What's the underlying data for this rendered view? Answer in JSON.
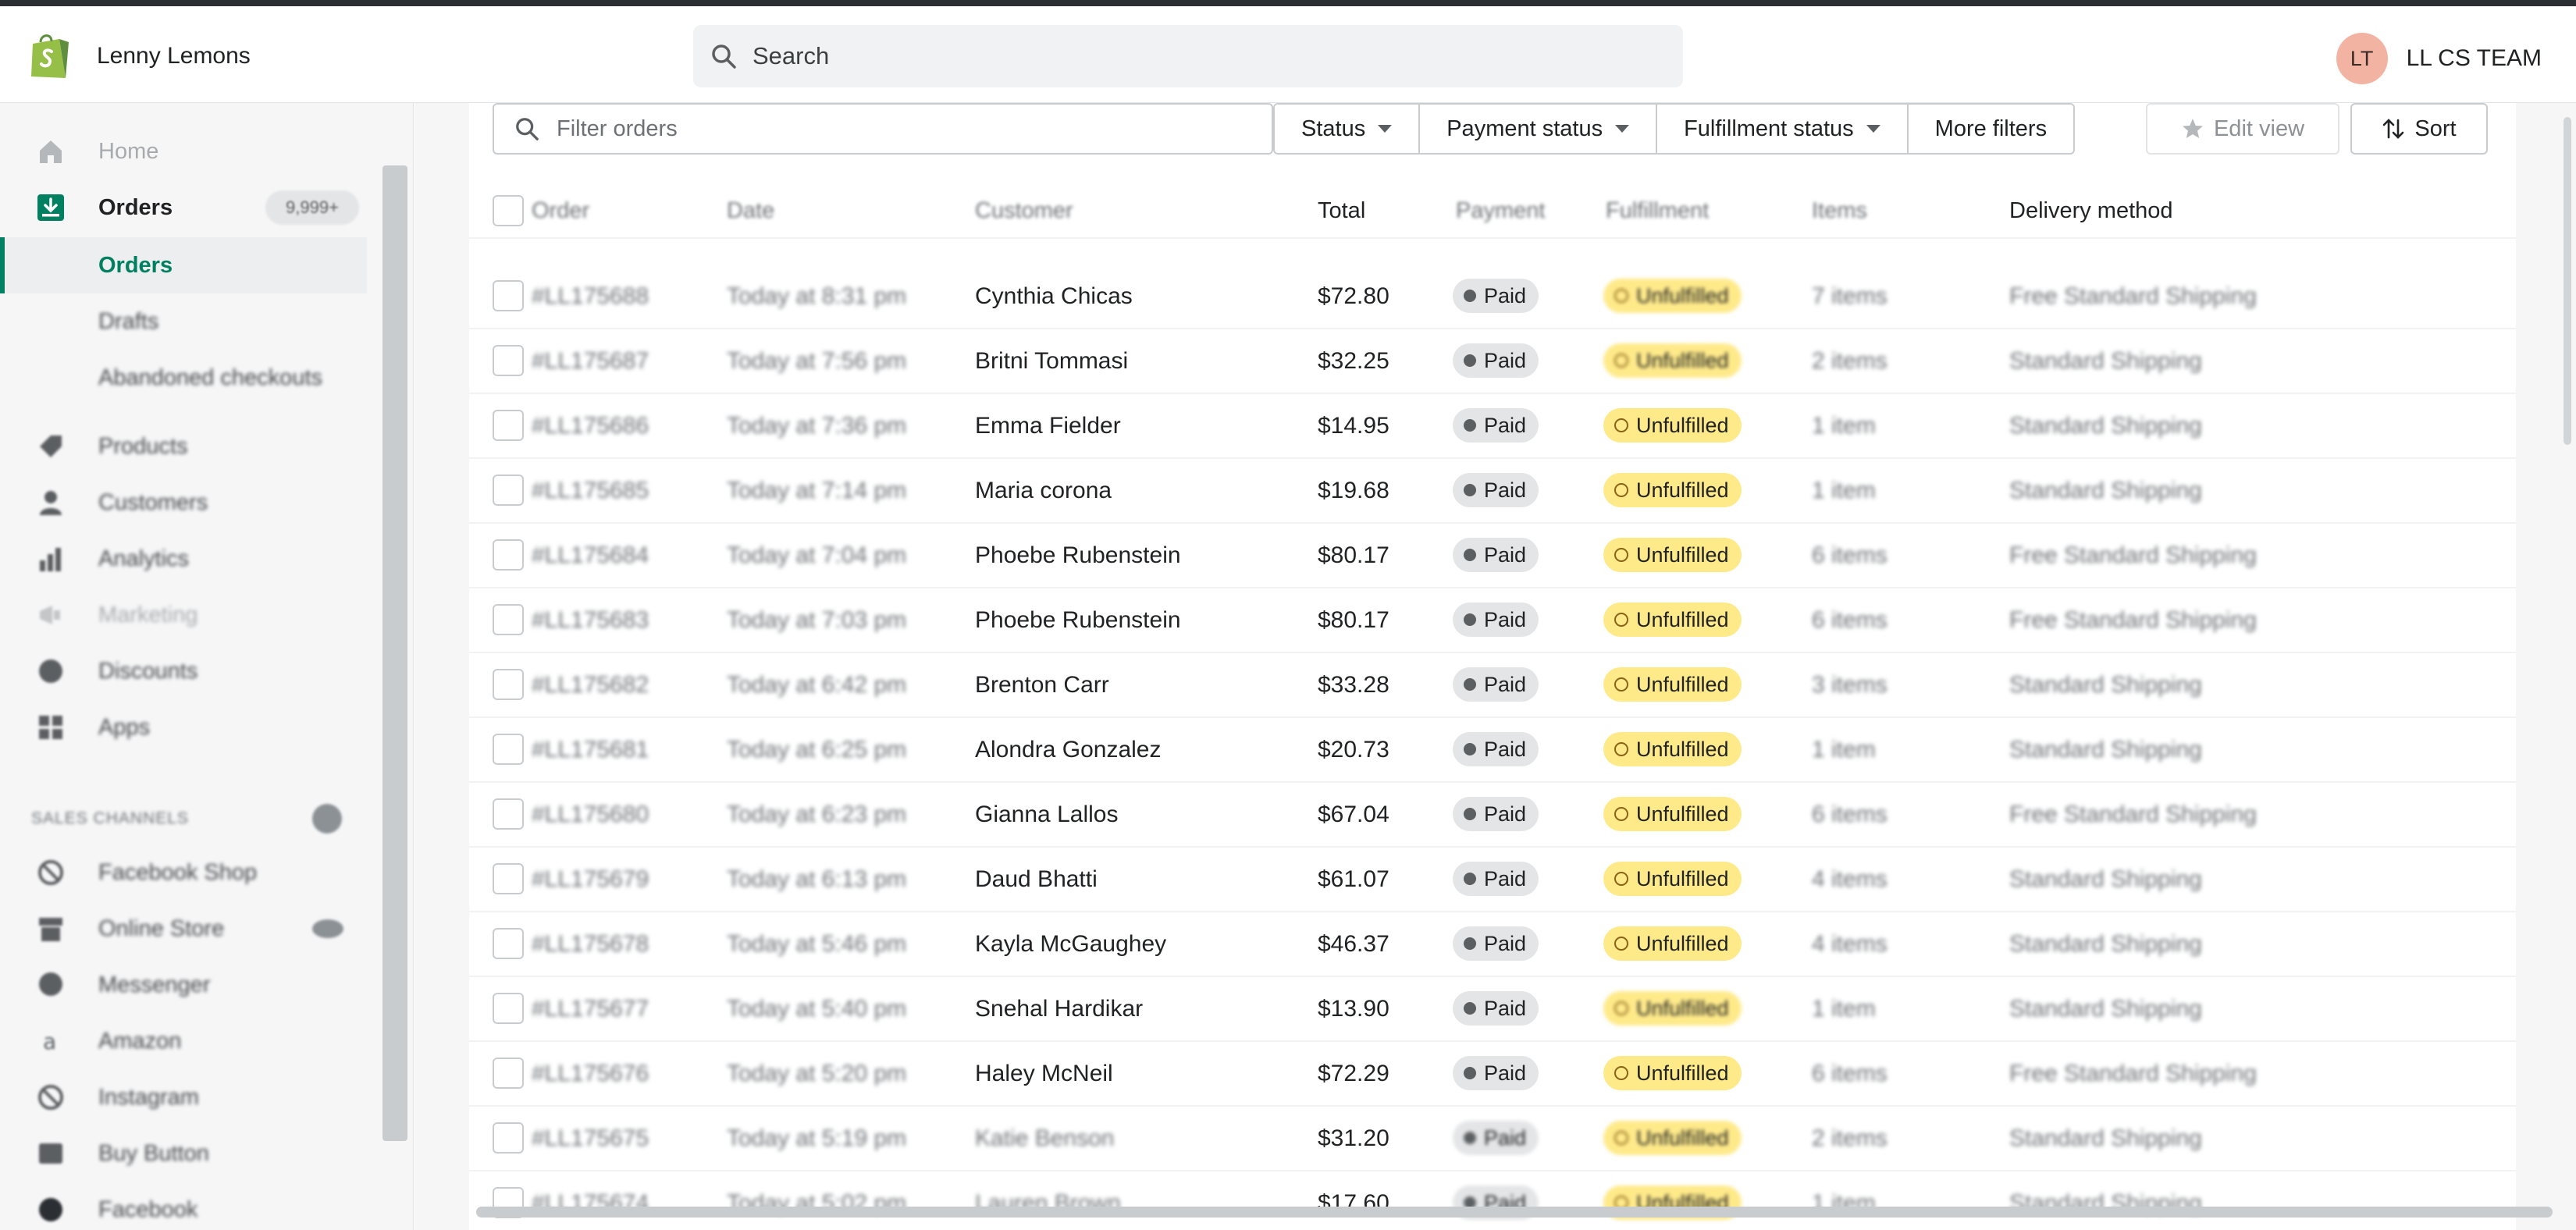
{
  "store": {
    "name": "Lenny Lemons",
    "logo_icon": "shopify-bag-icon"
  },
  "search": {
    "placeholder": "Search"
  },
  "user": {
    "initials": "LT",
    "name": "LL CS TEAM"
  },
  "sidebar": {
    "items": [
      {
        "label": "Home",
        "icon": "home-icon",
        "state": "faded"
      },
      {
        "label": "Orders",
        "icon": "orders-icon",
        "badge": "9,999+",
        "state": "active"
      },
      {
        "label": "Orders",
        "icon": "",
        "state": "sub-active"
      },
      {
        "label": "Drafts",
        "icon": "",
        "state": "sub"
      },
      {
        "label": "Abandoned checkouts",
        "icon": "",
        "state": "sub"
      },
      {
        "label": "Products",
        "icon": "tag-icon",
        "state": "blur"
      },
      {
        "label": "Customers",
        "icon": "person-icon",
        "state": "blur"
      },
      {
        "label": "Analytics",
        "icon": "bar-chart-icon",
        "state": "blur"
      },
      {
        "label": "Marketing",
        "icon": "megaphone-icon",
        "state": "faded"
      },
      {
        "label": "Discounts",
        "icon": "discount-icon",
        "state": "blur"
      },
      {
        "label": "Apps",
        "icon": "apps-grid-icon",
        "state": "blur"
      }
    ],
    "sales_channels_title": "SALES CHANNELS",
    "channels": [
      {
        "label": "Facebook Shop",
        "icon": "no-entry-icon"
      },
      {
        "label": "Online Store",
        "icon": "store-icon",
        "eye": true
      },
      {
        "label": "Messenger",
        "icon": "messenger-icon"
      },
      {
        "label": "Amazon",
        "icon": "amazon-icon"
      },
      {
        "label": "Instagram",
        "icon": "no-entry-icon"
      },
      {
        "label": "Buy Button",
        "icon": "buy-button-icon"
      },
      {
        "label": "Facebook",
        "icon": "facebook-icon"
      }
    ]
  },
  "filters": {
    "placeholder": "Filter orders",
    "buttons": [
      "Status",
      "Payment status",
      "Fulfillment status",
      "More filters"
    ],
    "edit_view": "Edit view",
    "sort": "Sort"
  },
  "table": {
    "headers": [
      "Order",
      "Date",
      "Customer",
      "Total",
      "Payment",
      "Fulfillment",
      "Items",
      "Delivery method"
    ],
    "rows": [
      {
        "order": "#LL175688",
        "date": "Today at 8:31 pm",
        "customer": "Cynthia Chicas",
        "total": "$72.80",
        "payment": "Paid",
        "fulfillment": "Unfulfilled",
        "items": "7 items",
        "delivery": "Free Standard Shipping"
      },
      {
        "order": "#LL175687",
        "date": "Today at 7:56 pm",
        "customer": "Britni Tommasi",
        "total": "$32.25",
        "payment": "Paid",
        "fulfillment": "Unfulfilled",
        "items": "2 items",
        "delivery": "Standard Shipping"
      },
      {
        "order": "#LL175686",
        "date": "Today at 7:36 pm",
        "customer": "Emma Fielder",
        "total": "$14.95",
        "payment": "Paid",
        "fulfillment": "Unfulfilled",
        "items": "1 item",
        "delivery": "Standard Shipping"
      },
      {
        "order": "#LL175685",
        "date": "Today at 7:14 pm",
        "customer": "Maria corona",
        "total": "$19.68",
        "payment": "Paid",
        "fulfillment": "Unfulfilled",
        "items": "1 item",
        "delivery": "Standard Shipping"
      },
      {
        "order": "#LL175684",
        "date": "Today at 7:04 pm",
        "customer": "Phoebe Rubenstein",
        "total": "$80.17",
        "payment": "Paid",
        "fulfillment": "Unfulfilled",
        "items": "6 items",
        "delivery": "Free Standard Shipping"
      },
      {
        "order": "#LL175683",
        "date": "Today at 7:03 pm",
        "customer": "Phoebe Rubenstein",
        "total": "$80.17",
        "payment": "Paid",
        "fulfillment": "Unfulfilled",
        "items": "6 items",
        "delivery": "Free Standard Shipping"
      },
      {
        "order": "#LL175682",
        "date": "Today at 6:42 pm",
        "customer": "Brenton Carr",
        "total": "$33.28",
        "payment": "Paid",
        "fulfillment": "Unfulfilled",
        "items": "3 items",
        "delivery": "Standard Shipping"
      },
      {
        "order": "#LL175681",
        "date": "Today at 6:25 pm",
        "customer": "Alondra Gonzalez",
        "total": "$20.73",
        "payment": "Paid",
        "fulfillment": "Unfulfilled",
        "items": "1 item",
        "delivery": "Standard Shipping"
      },
      {
        "order": "#LL175680",
        "date": "Today at 6:23 pm",
        "customer": "Gianna Lallos",
        "total": "$67.04",
        "payment": "Paid",
        "fulfillment": "Unfulfilled",
        "items": "6 items",
        "delivery": "Free Standard Shipping"
      },
      {
        "order": "#LL175679",
        "date": "Today at 6:13 pm",
        "customer": "Daud Bhatti",
        "total": "$61.07",
        "payment": "Paid",
        "fulfillment": "Unfulfilled",
        "items": "4 items",
        "delivery": "Standard Shipping"
      },
      {
        "order": "#LL175678",
        "date": "Today at 5:46 pm",
        "customer": "Kayla McGaughey",
        "total": "$46.37",
        "payment": "Paid",
        "fulfillment": "Unfulfilled",
        "items": "4 items",
        "delivery": "Standard Shipping"
      },
      {
        "order": "#LL175677",
        "date": "Today at 5:40 pm",
        "customer": "Snehal Hardikar",
        "total": "$13.90",
        "payment": "Paid",
        "fulfillment": "Unfulfilled",
        "items": "1 item",
        "delivery": "Standard Shipping"
      },
      {
        "order": "#LL175676",
        "date": "Today at 5:20 pm",
        "customer": "Haley McNeil",
        "total": "$72.29",
        "payment": "Paid",
        "fulfillment": "Unfulfilled",
        "items": "6 items",
        "delivery": "Free Standard Shipping"
      },
      {
        "order": "#LL175675",
        "date": "Today at 5:19 pm",
        "customer": "Katie Benson",
        "total": "$31.20",
        "payment": "Paid",
        "fulfillment": "Unfulfilled",
        "items": "2 items",
        "delivery": "Standard Shipping"
      },
      {
        "order": "#LL175674",
        "date": "Today at 5:02 pm",
        "customer": "Lauren Brown",
        "total": "$17.60",
        "payment": "Paid",
        "fulfillment": "Unfulfilled",
        "items": "1 item",
        "delivery": "Standard Shipping"
      }
    ]
  },
  "colors": {
    "brand_green": "#008060",
    "paid_pill": "#e4e5e7",
    "unfulfilled_pill": "#ffea8a",
    "avatar": "#f3b3a2"
  }
}
